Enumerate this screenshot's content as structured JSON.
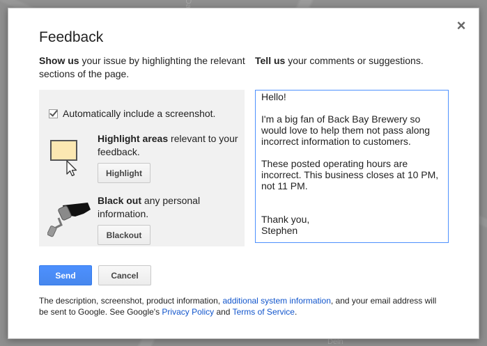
{
  "background": {
    "labels": [
      "Dartmouth St",
      "Deln"
    ]
  },
  "dialog": {
    "title": "Feedback",
    "close_glyph": "×",
    "show_us": {
      "bold": "Show us",
      "rest": " your issue by highlighting the relevant sections of the page."
    },
    "tell_us": {
      "bold": "Tell us",
      "rest": " your comments or suggestions."
    },
    "screenshot_checkbox": {
      "label": "Automatically include a screenshot.",
      "checked": true
    },
    "highlight": {
      "bold": "Highlight areas",
      "rest": " relevant to your feedback.",
      "button_label": "Highlight",
      "swatch_color": "#fce8b2"
    },
    "blackout": {
      "bold": "Black out",
      "rest": " any personal information.",
      "button_label": "Blackout"
    },
    "comments_text": "Hello!\n\nI'm a big fan of Back Bay Brewery so\nwould love to help them not pass along\nincorrect information to customers.\n\nThese posted operating hours are\nincorrect. This business closes at 10 PM,\nnot 11 PM.\n\n\nThank you,\nStephen",
    "send_label": "Send",
    "cancel_label": "Cancel",
    "footer": {
      "part1": "The description, screenshot, product information, ",
      "link1": "additional system information",
      "part2": ", and your email address will be sent to Google. See Google's ",
      "link2": "Privacy Policy",
      "part3": " and ",
      "link3": "Terms of Service",
      "part4": "."
    },
    "colors": {
      "accent_blue": "#4d90fe",
      "link_blue": "#1155cc"
    }
  }
}
